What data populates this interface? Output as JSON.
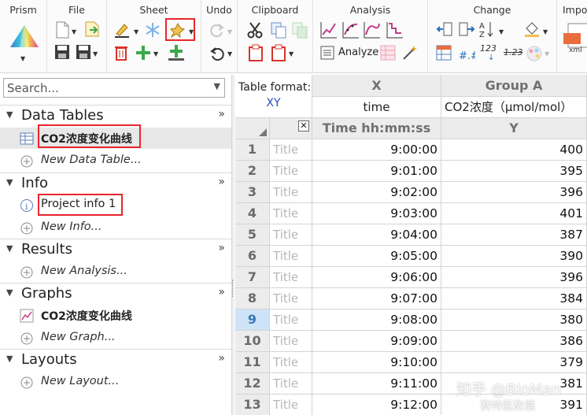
{
  "ribbon": {
    "groups": {
      "prism": "Prism",
      "file": "File",
      "sheet": "Sheet",
      "undo": "Undo",
      "clipboard": "Clipboard",
      "analysis": "Analysis",
      "change": "Change",
      "import": "Impo"
    },
    "analyze_label": "Analyze",
    "change_123": "123",
    "change_123_strike": "1.23",
    "import_icon_text": "txt\nxml",
    "accent": "#e8262b"
  },
  "navigator": {
    "search_placeholder": "Search...",
    "sections": {
      "data_tables": {
        "title": "Data Tables",
        "items": [
          "CO2浓度变化曲线"
        ],
        "new": "New Data Table..."
      },
      "info": {
        "title": "Info",
        "items": [
          "Project info 1"
        ],
        "new": "New Info..."
      },
      "results": {
        "title": "Results",
        "new": "New Analysis..."
      },
      "graphs": {
        "title": "Graphs",
        "items": [
          "CO2浓度变化曲线"
        ],
        "new": "New Graph..."
      },
      "layouts": {
        "title": "Layouts",
        "new": "New Layout..."
      }
    }
  },
  "table": {
    "format_label": "Table format:",
    "format_value": "XY",
    "x_header": "X",
    "x_title": "time",
    "x_subheader": "Time hh:mm:ss",
    "group_header": "Group A",
    "group_title": "CO2浓度（μmol/mol）",
    "y_subheader": "Y",
    "title_placeholder": "Title",
    "selected_row": 9,
    "rows": [
      {
        "n": "1",
        "x": "9:00:00",
        "y": "400"
      },
      {
        "n": "2",
        "x": "9:01:00",
        "y": "395"
      },
      {
        "n": "3",
        "x": "9:02:00",
        "y": "396"
      },
      {
        "n": "4",
        "x": "9:03:00",
        "y": "401"
      },
      {
        "n": "5",
        "x": "9:04:00",
        "y": "387"
      },
      {
        "n": "6",
        "x": "9:05:00",
        "y": "390"
      },
      {
        "n": "7",
        "x": "9:06:00",
        "y": "396"
      },
      {
        "n": "8",
        "x": "9:07:00",
        "y": "384"
      },
      {
        "n": "9",
        "x": "9:08:00",
        "y": "380"
      },
      {
        "n": "10",
        "x": "9:09:00",
        "y": "386"
      },
      {
        "n": "11",
        "x": "9:10:00",
        "y": "379"
      },
      {
        "n": "12",
        "x": "9:11:00",
        "y": "381"
      },
      {
        "n": "13",
        "x": "9:12:00",
        "y": "391"
      }
    ]
  },
  "watermark": {
    "line1": "知乎 @BioMan",
    "line2": "赛特医数据"
  }
}
